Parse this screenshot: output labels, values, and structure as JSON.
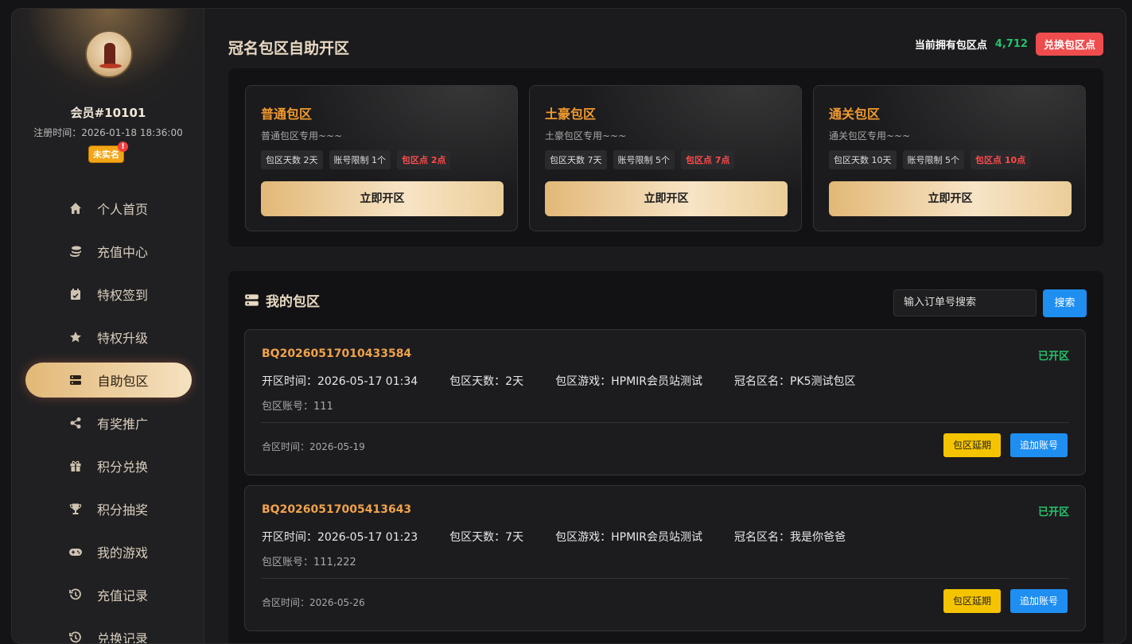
{
  "user": {
    "name": "会员#10101",
    "reg_time": "注册时间：2026-01-18 18:36:00",
    "badge": "未实名",
    "badge_alert": "!"
  },
  "nav": [
    {
      "label": "个人首页",
      "icon": "home-icon"
    },
    {
      "label": "充值中心",
      "icon": "coins-icon"
    },
    {
      "label": "特权签到",
      "icon": "calendar-check-icon"
    },
    {
      "label": "特权升级",
      "icon": "star-icon"
    },
    {
      "label": "自助包区",
      "icon": "server-icon",
      "active": true
    },
    {
      "label": "有奖推广",
      "icon": "share-icon"
    },
    {
      "label": "积分兑换",
      "icon": "gift-icon"
    },
    {
      "label": "积分抽奖",
      "icon": "trophy-icon"
    },
    {
      "label": "我的游戏",
      "icon": "gamepad-icon"
    },
    {
      "label": "充值记录",
      "icon": "history-icon"
    },
    {
      "label": "兑换记录",
      "icon": "history-icon"
    }
  ],
  "header": {
    "title": "冠名包区自助开区",
    "points_label": "当前拥有包区点",
    "points_value": "4,712",
    "exchange_button": "兑换包区点"
  },
  "plans": [
    {
      "name": "普通包区",
      "desc": "普通包区专用~~~",
      "days": "包区天数 2天",
      "limit": "账号限制 1个",
      "cost": "包区点 2点",
      "button": "立即开区"
    },
    {
      "name": "土豪包区",
      "desc": "土豪包区专用~~~",
      "days": "包区天数 7天",
      "limit": "账号限制 5个",
      "cost": "包区点 7点",
      "button": "立即开区"
    },
    {
      "name": "通关包区",
      "desc": "通关包区专用~~~",
      "days": "包区天数 10天",
      "limit": "账号限制 5个",
      "cost": "包区点 10点",
      "button": "立即开区"
    }
  ],
  "mine": {
    "title": "我的包区",
    "search_placeholder": "输入订单号搜索",
    "search_button": "搜索",
    "orders": [
      {
        "no": "BQ20260517010433584",
        "status": "已开区",
        "open_time": "开区时间：2026-05-17 01:34",
        "days": "包区天数：2天",
        "game": "包区游戏：HPMIR会员站测试",
        "zone_name": "冠名区名：PK5测试包区",
        "account": "包区账号：111",
        "merge_time": "合区时间：2026-05-19",
        "extend_button": "包区延期",
        "add_button": "追加账号"
      },
      {
        "no": "BQ20260517005413643",
        "status": "已开区",
        "open_time": "开区时间：2026-05-17 01:23",
        "days": "包区天数：7天",
        "game": "包区游戏：HPMIR会员站测试",
        "zone_name": "冠名区名：我是你爸爸",
        "account": "包区账号：111,222",
        "merge_time": "合区时间：2026-05-26",
        "extend_button": "包区延期",
        "add_button": "追加账号"
      }
    ]
  },
  "colors": {
    "accent_gold": "#e2b877",
    "plan_name": "#f29a2e",
    "status_green": "#25c26b",
    "danger_red": "#ef4c4e",
    "primary_blue": "#1f8ef1",
    "warn_yellow": "#f5c400"
  }
}
